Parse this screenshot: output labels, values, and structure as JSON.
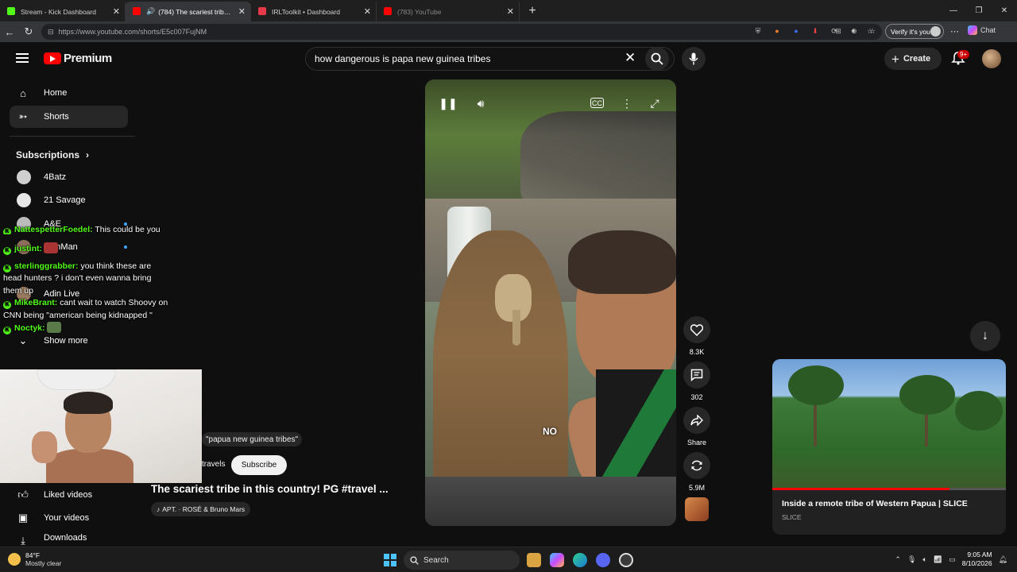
{
  "browser": {
    "tabs": [
      {
        "title": "Stream - Kick Dashboard",
        "favicon_color": "#53fc18",
        "active": false
      },
      {
        "title": "(784) The scariest tribe in this",
        "favicon_color": "#ff0000",
        "active": true
      },
      {
        "title": "IRLToolkit • Dashboard",
        "favicon_color": "#e8394a",
        "active": false
      },
      {
        "title": "(783) YouTube",
        "favicon_color": "#ff0000",
        "active": false
      }
    ],
    "url": "https://www.youtube.com/shorts/E5c007FujNM",
    "verify_label": "Verify it's you",
    "chat_label": "Chat"
  },
  "header": {
    "logo_text": "Premium",
    "search_value": "how dangerous is papa new guinea tribes",
    "create_label": "Create",
    "notification_badge": "9+"
  },
  "sidebar": {
    "items": [
      {
        "label": "Home",
        "icon": "home-icon"
      },
      {
        "label": "Shorts",
        "icon": "shorts-icon"
      }
    ],
    "subscriptions_heading": "Subscriptions",
    "subscriptions": [
      {
        "label": "4Batz",
        "color": "#cfcfcf"
      },
      {
        "label": "21 Savage",
        "color": "#e6e6e6"
      },
      {
        "label": "A&E",
        "color": "#bbbbbb"
      },
      {
        "label": "...onMan",
        "color": "#8c6f5a"
      },
      {
        "label": "Adin Live",
        "color": "#9a7a60"
      }
    ],
    "show_more": "Show more",
    "you_items": [
      {
        "label": "Liked videos",
        "icon": "thumbs-up-icon"
      },
      {
        "label": "Your videos",
        "icon": "play-square-icon"
      },
      {
        "label": "Downloads",
        "icon": "download-icon"
      }
    ]
  },
  "chat": {
    "lines": [
      {
        "user": "NattespetterFoedel:",
        "text": "This could be you"
      },
      {
        "user": "justint:",
        "text": ""
      },
      {
        "user": "sterlinggrabber:",
        "text": "you think these are head hunters ? i don't even wanna bring them up"
      },
      {
        "user": "MikeBrant:",
        "text": "cant wait to watch Shoovy on CNN being \"american being kidnapped \""
      },
      {
        "user": "Noctyk:",
        "text": ""
      }
    ]
  },
  "video": {
    "caption": "NO",
    "hashtag_chip": "\"papua new guinea tribes\"",
    "channel": "travels",
    "subscribe_label": "Subscribe",
    "title": "The scariest tribe in this country! PG #travel ...",
    "music": "APT. · ROSÉ & Bruno Mars"
  },
  "actions": {
    "likes": "8.3K",
    "comments": "302",
    "share": "Share",
    "remix": "5.9M"
  },
  "promo": {
    "title": "Inside a remote tribe of Western Papua | SLICE",
    "channel": "SLICE",
    "progress": 0.76
  },
  "taskbar": {
    "temperature": "84°F",
    "condition": "Mostly clear",
    "search": "Search",
    "time": "9:05 AM",
    "date": "8/10/2026"
  }
}
